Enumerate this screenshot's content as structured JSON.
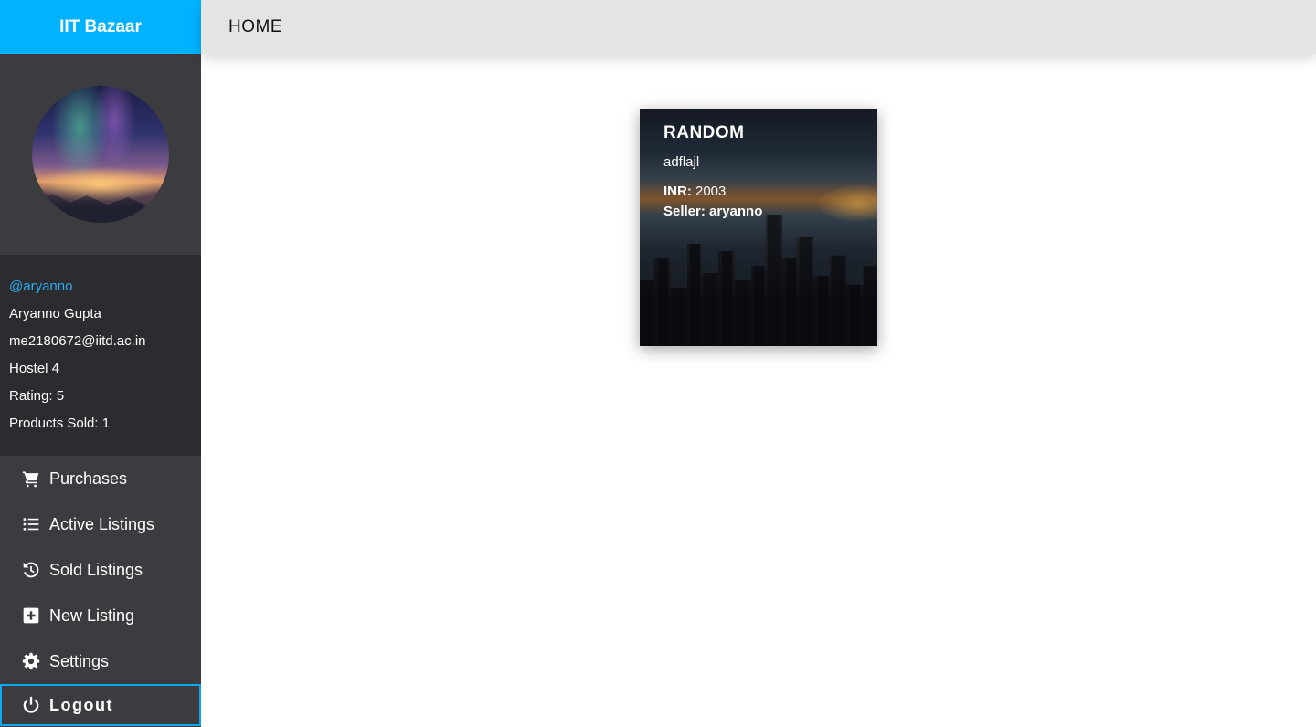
{
  "brand": {
    "name": "IIT Bazaar"
  },
  "topbar": {
    "home_label": "HOME"
  },
  "profile": {
    "handle": "@aryanno",
    "name": "Aryanno Gupta",
    "email": "me2180672@iitd.ac.in",
    "hostel": "Hostel 4",
    "rating": "Rating: 5",
    "products_sold": "Products Sold: 1"
  },
  "menu": {
    "items": [
      {
        "label": "Purchases",
        "icon": "cart-icon"
      },
      {
        "label": "Active Listings",
        "icon": "list-icon"
      },
      {
        "label": "Sold Listings",
        "icon": "history-icon"
      },
      {
        "label": "New Listing",
        "icon": "plus-square-icon"
      },
      {
        "label": "Settings",
        "icon": "gear-icon"
      },
      {
        "label": "Logout",
        "icon": "power-icon"
      }
    ]
  },
  "listing": {
    "title": "RANDOM",
    "description": "adflajl",
    "price_label": "INR:",
    "price_value": "2003",
    "seller_label": "Seller:",
    "seller_value": "aryanno"
  },
  "colors": {
    "accent": "#00b2ff",
    "sidebar": "#3b3b40",
    "profile_bg": "#2b2b30",
    "topbar": "#e4e4e4"
  }
}
